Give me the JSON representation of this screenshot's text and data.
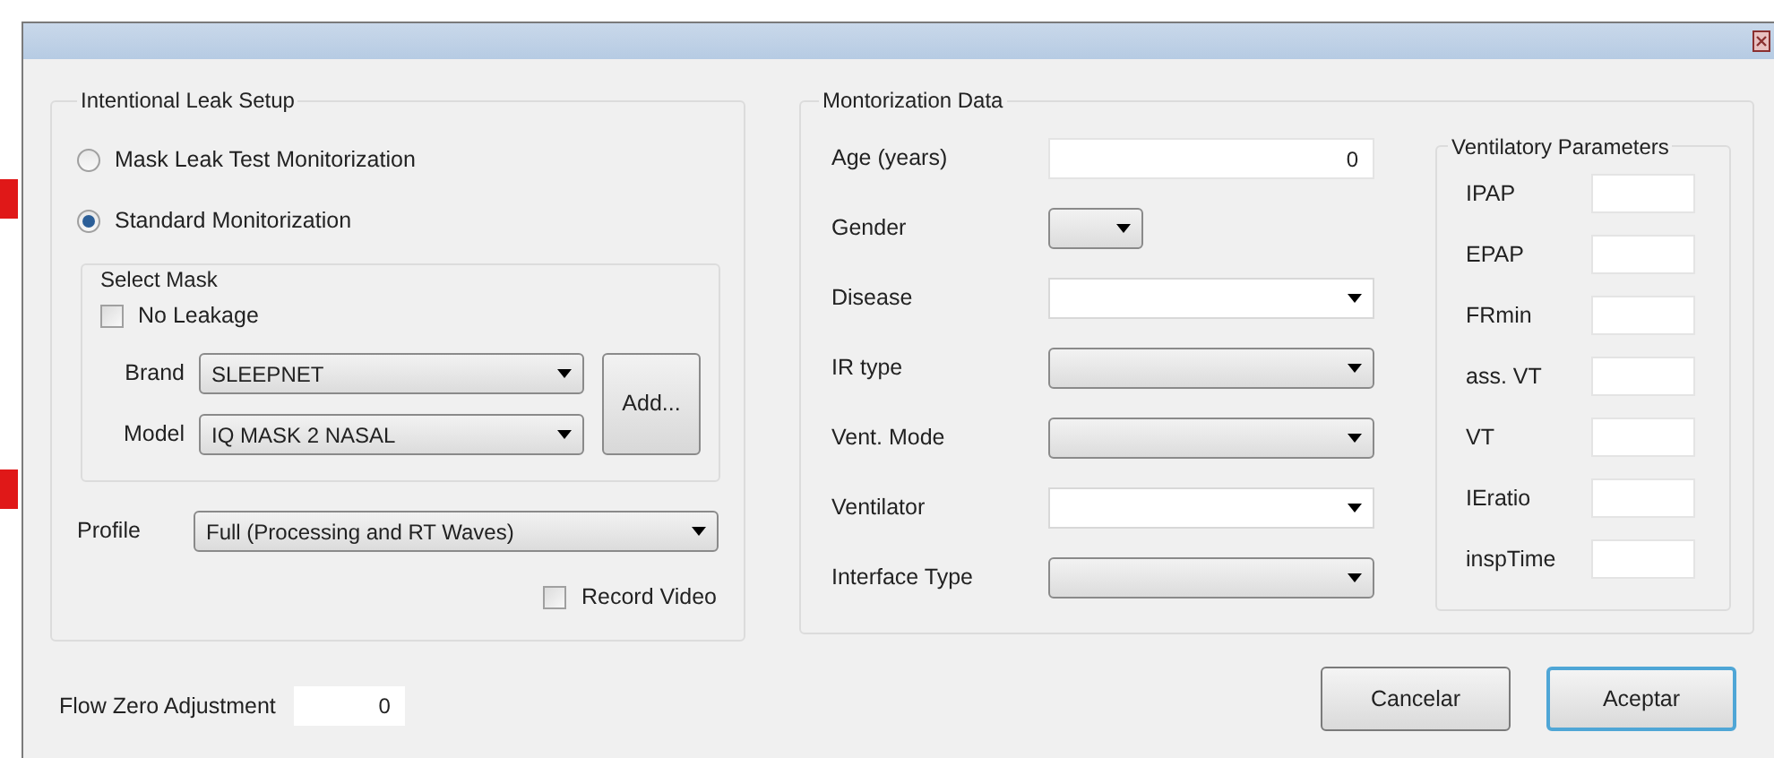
{
  "intentional_leak_setup": {
    "title": "Intentional Leak Setup",
    "monitoring_modes": [
      {
        "label": "Mask Leak Test Monitorization",
        "selected": false
      },
      {
        "label": "Standard Monitorization",
        "selected": true
      }
    ],
    "select_mask": {
      "title": "Select Mask",
      "no_leakage": {
        "label": "No Leakage",
        "checked": false
      },
      "brand": {
        "label": "Brand",
        "value": "SLEEPNET"
      },
      "model": {
        "label": "Model",
        "value": "IQ MASK 2 NASAL"
      },
      "add_button": "Add..."
    },
    "profile": {
      "label": "Profile",
      "value": "Full (Processing and RT Waves)"
    },
    "record_video": {
      "label": "Record Video",
      "checked": false
    }
  },
  "flow_zero_adjustment": {
    "label": "Flow Zero Adjustment",
    "value": "0"
  },
  "monitorization_data": {
    "title": "Montorization Data",
    "fields": [
      {
        "label": "Age (years)",
        "kind": "text",
        "value": "0"
      },
      {
        "label": "Gender",
        "kind": "small-dropdown"
      },
      {
        "label": "Disease",
        "kind": "combo"
      },
      {
        "label": "IR type",
        "kind": "dropdown"
      },
      {
        "label": "Vent. Mode",
        "kind": "dropdown"
      },
      {
        "label": "Ventilator",
        "kind": "combo"
      },
      {
        "label": "Interface Type",
        "kind": "dropdown"
      }
    ]
  },
  "ventilatory_parameters": {
    "title": "Ventilatory Parameters",
    "fields": [
      {
        "label": "IPAP"
      },
      {
        "label": "EPAP"
      },
      {
        "label": "FRmin"
      },
      {
        "label": "ass. VT"
      },
      {
        "label": "VT"
      },
      {
        "label": "IEratio"
      },
      {
        "label": "inspTime"
      }
    ]
  },
  "buttons": [
    {
      "label": "Cancelar",
      "default": false
    },
    {
      "label": "Aceptar",
      "default": true
    }
  ]
}
